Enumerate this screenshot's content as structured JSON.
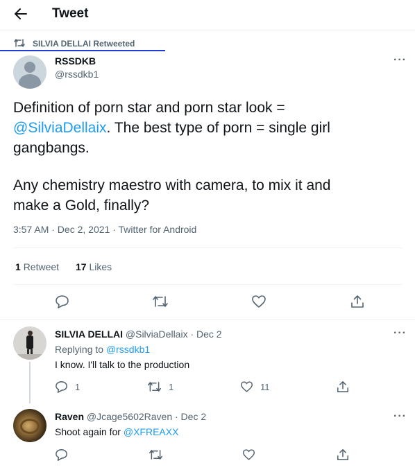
{
  "header": {
    "title": "Tweet"
  },
  "retweet_banner": {
    "text": "SILVIA DELLAI Retweeted"
  },
  "main_tweet": {
    "name": "RSSDKB",
    "handle": "@rssdkb1",
    "text_line1": "Definition of porn star and porn star look =",
    "mention": "@SilviaDellaix",
    "text_line2_rest": ". The best type of porn = single girl",
    "text_line3": "gangbangs.",
    "text_line4": "Any chemistry maestro with camera, to mix it and",
    "text_line5": "make a Gold, finally?",
    "meta": "3:57 AM · Dec 2, 2021 · Twitter for Android",
    "retweet_count": "1",
    "retweet_label": "Retweet",
    "like_count": "17",
    "like_label": "Likes"
  },
  "replies": [
    {
      "name": "SILVIA DELLAI",
      "handle_date": "@SilviaDellaix · Dec 2",
      "replying_prefix": "Replying to ",
      "replying_handle": "@rssdkb1",
      "text": "I know. I'll talk to the production",
      "reply_count": "1",
      "retweet_count": "1",
      "like_count": "11"
    },
    {
      "name": "Raven",
      "handle_date": "@Jcage5602Raven · Dec 2",
      "text_prefix": "Shoot again for ",
      "text_mention": "@XFREAXX"
    }
  ],
  "colors": {
    "accent": "#1d9bf0",
    "secondary_text": "#536471",
    "divider": "#eff3f4",
    "underline": "#1d3fd1"
  }
}
